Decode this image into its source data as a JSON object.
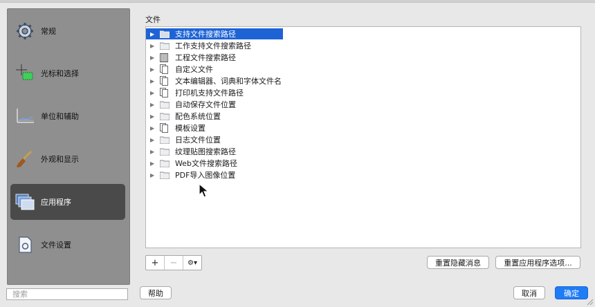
{
  "sidebar": {
    "items": [
      {
        "label": "常规",
        "icon": "gear-icon"
      },
      {
        "label": "光标和选择",
        "icon": "cursor-select-icon"
      },
      {
        "label": "单位和辅助",
        "icon": "units-icon"
      },
      {
        "label": "外观和显示",
        "icon": "paintbrush-icon"
      },
      {
        "label": "应用程序",
        "icon": "application-windows-icon",
        "selected": true
      },
      {
        "label": "文件设置",
        "icon": "file-settings-icon"
      }
    ],
    "search_placeholder": "搜索"
  },
  "main": {
    "section_title": "文件",
    "tree": [
      {
        "label": "支持文件搜索路径",
        "icon": "folder-icon",
        "selected": true
      },
      {
        "label": "工作支持文件搜索路径",
        "icon": "folder-icon"
      },
      {
        "label": "工程文件搜索路径",
        "icon": "cabinet-icon"
      },
      {
        "label": "自定义文件",
        "icon": "document-icon"
      },
      {
        "label": "文本编辑器、词典和字体文件名",
        "icon": "document-icon"
      },
      {
        "label": "打印机支持文件路径",
        "icon": "document-icon"
      },
      {
        "label": "自动保存文件位置",
        "icon": "folder-icon"
      },
      {
        "label": "配色系统位置",
        "icon": "folder-icon"
      },
      {
        "label": "模板设置",
        "icon": "document-icon"
      },
      {
        "label": "日志文件位置",
        "icon": "folder-icon"
      },
      {
        "label": "纹理贴图搜索路径",
        "icon": "folder-icon"
      },
      {
        "label": "Web文件搜索路径",
        "icon": "folder-icon"
      },
      {
        "label": "PDF导入图像位置",
        "icon": "folder-icon"
      }
    ],
    "toolbar": {
      "add_label": "+",
      "remove_label": "−",
      "gear_label": "⚙▾",
      "reset_hidden_label": "重置隐藏消息",
      "reset_app_options_label": "重置应用程序选项..."
    }
  },
  "footer": {
    "help_label": "帮助",
    "cancel_label": "取消",
    "ok_label": "确定"
  },
  "colors": {
    "sidebar_bg": "#8f8f8f",
    "sidebar_selected": "#4a4a4a",
    "selection_blue": "#1e63d6",
    "primary_button": "#1f7cf5"
  }
}
